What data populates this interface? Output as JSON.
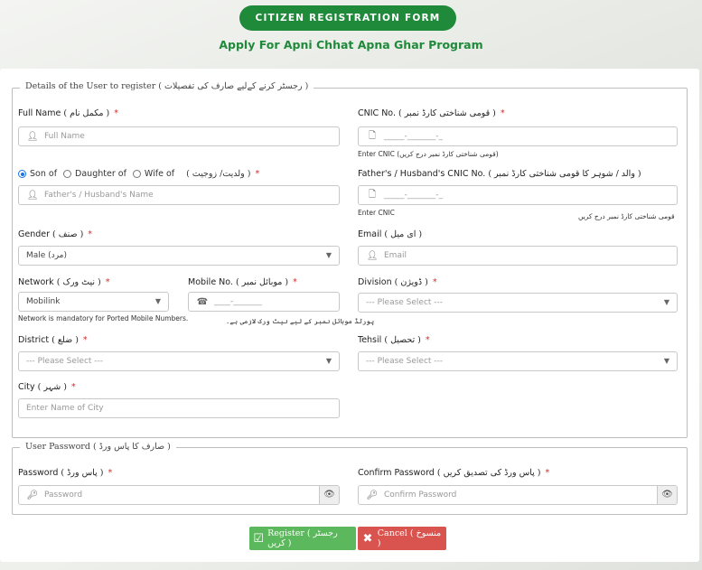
{
  "header": {
    "title": "CITIZEN REGISTRATION FORM",
    "subtitle": "Apply For Apni Chhat Apna Ghar Program"
  },
  "user_details": {
    "legend": "Details of the User to register ( رجسٹر کرنے کےلیے صارف کی تفصیلات )",
    "full_name": {
      "label": "Full Name",
      "urdu": "( مکمل نام )",
      "placeholder": "Full Name",
      "icon": "user-icon"
    },
    "cnic": {
      "label": "CNIC No.",
      "urdu": "( قومی شناختی کارڈ نمبر )",
      "placeholder": "_____-_______-_",
      "hint": "Enter CNIC (قومی شناختی کارڈ نمبر درج کریں)",
      "icon": "document-icon"
    },
    "relation": {
      "options": [
        "Son of",
        "Daughter of",
        "Wife of"
      ],
      "selected": "Son of",
      "urdu": "( ولدیت/ زوجیت )",
      "placeholder": "Father's / Husband's Name",
      "icon": "user-icon"
    },
    "father_cnic": {
      "label": "Father's / Husband's CNIC No.",
      "urdu": "( والد / شوہر کا قومی شناختی کارڈ نمبر )",
      "placeholder": "_____-_______-_",
      "hint": "Enter CNIC",
      "hint_urdu": "قومی شناختی کارڈ نمبر درج کریں",
      "icon": "document-icon"
    },
    "gender": {
      "label": "Gender",
      "urdu": "( صنف )",
      "value": "Male (مرد)"
    },
    "email": {
      "label": "Email",
      "urdu": "( ای میل )",
      "placeholder": "Email",
      "icon": "user-icon"
    },
    "network": {
      "label": "Network",
      "urdu": "( نیٹ ورک )",
      "value": "Mobilink",
      "hint": "Network is mandatory for Ported Mobile Numbers."
    },
    "mobile": {
      "label": "Mobile No.",
      "urdu": "( موبائل نمبر )",
      "placeholder": "____-_______",
      "hint_urdu": "پورٹڈ موبائل نمبر کے لیے نیٹ ورک لازمی ہے۔",
      "icon": "phone-icon"
    },
    "division": {
      "label": "Division",
      "urdu": "( ڈویژن )",
      "value": "--- Please Select ---"
    },
    "district": {
      "label": "District",
      "urdu": "( ضلع )",
      "value": "--- Please Select ---"
    },
    "tehsil": {
      "label": "Tehsil",
      "urdu": "( تحصیل )",
      "value": "--- Please Select ---"
    },
    "city": {
      "label": "City",
      "urdu": "( شہر )",
      "placeholder": "Enter Name of City"
    }
  },
  "password_section": {
    "legend": "User Password ( صارف کا پاس ورڈ )",
    "password": {
      "label": "Password",
      "urdu": "( پاس ورڈ )",
      "placeholder": "Password",
      "icon": "key-icon"
    },
    "confirm": {
      "label": "Confirm Password",
      "urdu": "( پاس ورڈ کی تصدیق کریں )",
      "placeholder": "Confirm Password",
      "icon": "key-icon"
    }
  },
  "buttons": {
    "register": "Register ( رجسٹر کریں )",
    "cancel": "Cancel ( منسوخ )"
  },
  "colors": {
    "brand_green": "#1f8a3a",
    "register_green": "#5cb85c",
    "cancel_red": "#d9534f",
    "required": "#d02b2b"
  }
}
